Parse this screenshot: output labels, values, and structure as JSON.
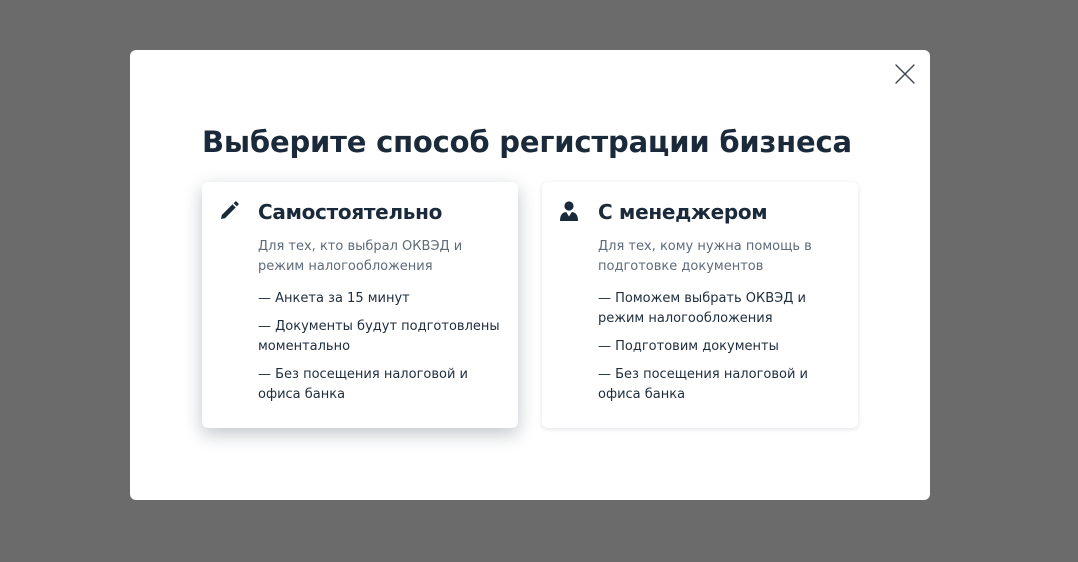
{
  "modal": {
    "title": "Выберите способ регистрации бизнеса"
  },
  "options": [
    {
      "icon": "pencil-icon",
      "title": "Самостоятельно",
      "description": "Для тех, кто выбрал ОКВЭД и режим налогообложения",
      "features": [
        "— Анкета за 15 минут",
        "— Документы будут подготовлены моментально",
        "— Без посещения налоговой и офиса банка"
      ]
    },
    {
      "icon": "person-icon",
      "title": "С менеджером",
      "description": "Для тех, кому нужна помощь в подготовке документов",
      "features": [
        "— Поможем выбрать ОКВЭД и режим налогообложения",
        "— Подготовим документы",
        "— Без посещения налоговой и офиса банка"
      ]
    }
  ],
  "colors": {
    "overlay": "#6b6b6b",
    "title": "#1b2a3a",
    "description": "#5f6b78",
    "icon": "#1b2a3a"
  }
}
